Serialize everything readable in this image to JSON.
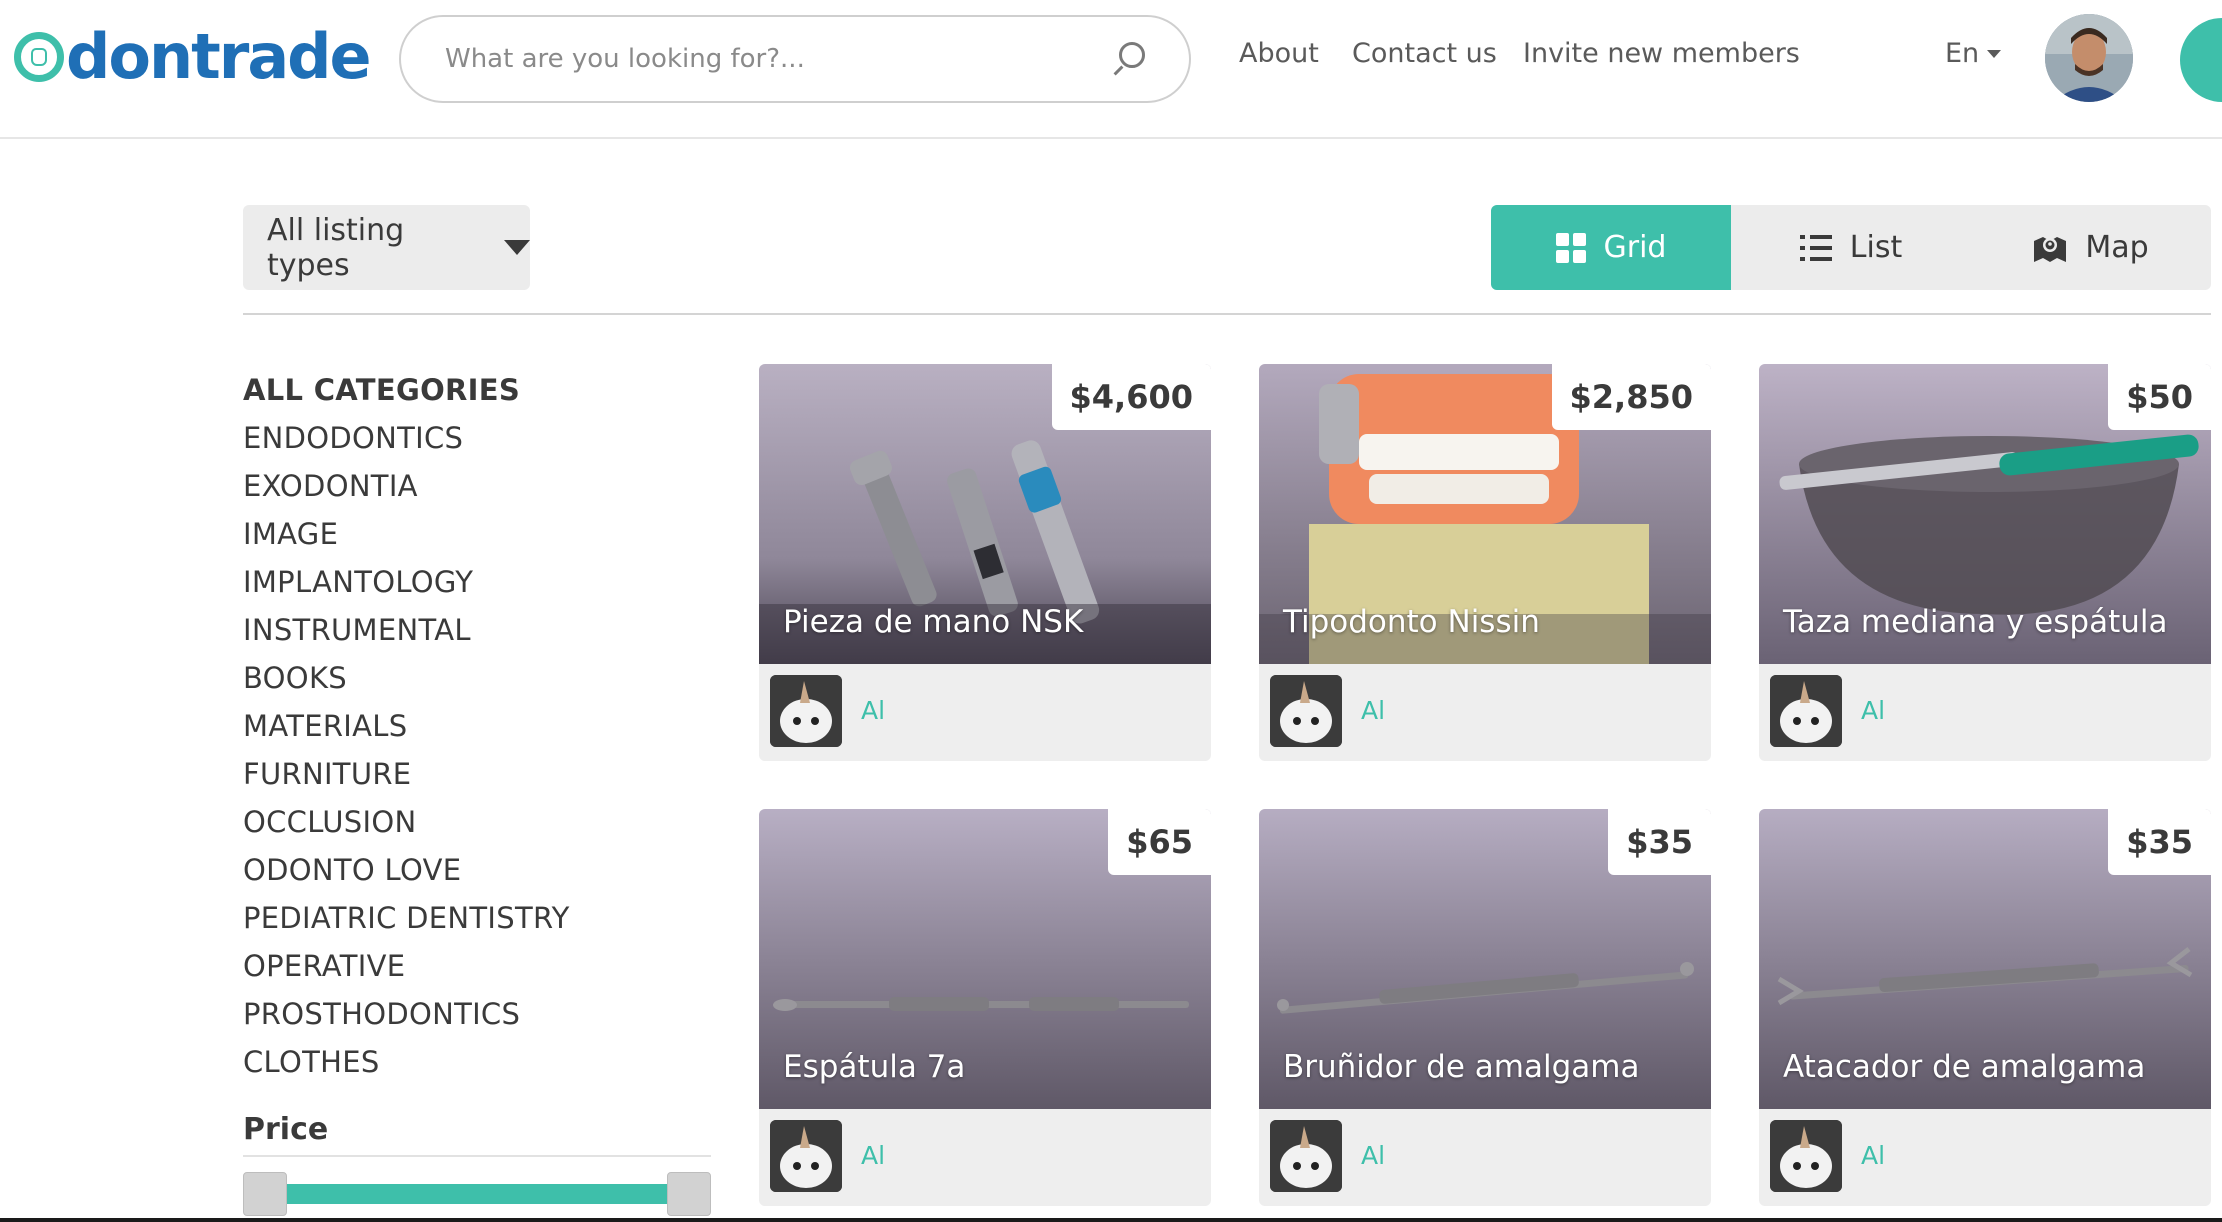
{
  "header": {
    "logo_letter": "O",
    "logo_rest": "dontrade",
    "search_placeholder": "What are you looking for?...",
    "nav": [
      "About",
      "Contact us",
      "Invite new members"
    ],
    "language": "En"
  },
  "toolbar": {
    "listing_types": "All listing types",
    "views": [
      "Grid",
      "List",
      "Map"
    ],
    "active_view": "Grid"
  },
  "sidebar": {
    "categories": [
      "ALL CATEGORIES",
      "ENDODONTICS",
      "EXODONTIA",
      "IMAGE",
      "IMPLANTOLOGY",
      "INSTRUMENTAL",
      "BOOKS",
      "MATERIALS",
      "FURNITURE",
      "OCCLUSION",
      "ODONTO LOVE",
      "PEDIATRIC DENTISTRY",
      "OPERATIVE",
      "PROSTHODONTICS",
      "CLOTHES"
    ],
    "price_label": "Price"
  },
  "listings": [
    {
      "title": "Pieza de mano NSK",
      "price": "$4,600",
      "seller": "Al"
    },
    {
      "title": "Tipodonto Nissin",
      "price": "$2,850",
      "seller": "Al"
    },
    {
      "title": "Taza mediana y espátula",
      "price": "$50",
      "seller": "Al"
    },
    {
      "title": "Espátula 7a",
      "price": "$65",
      "seller": "Al"
    },
    {
      "title": "Bruñidor de amalgama",
      "price": "$35",
      "seller": "Al"
    },
    {
      "title": "Atacador de amalgama",
      "price": "$35",
      "seller": "Al"
    }
  ],
  "colors": {
    "accent": "#3ebfaa",
    "brand_blue": "#1f6fb6",
    "text": "#3a3a3a",
    "panel": "#ececec"
  }
}
